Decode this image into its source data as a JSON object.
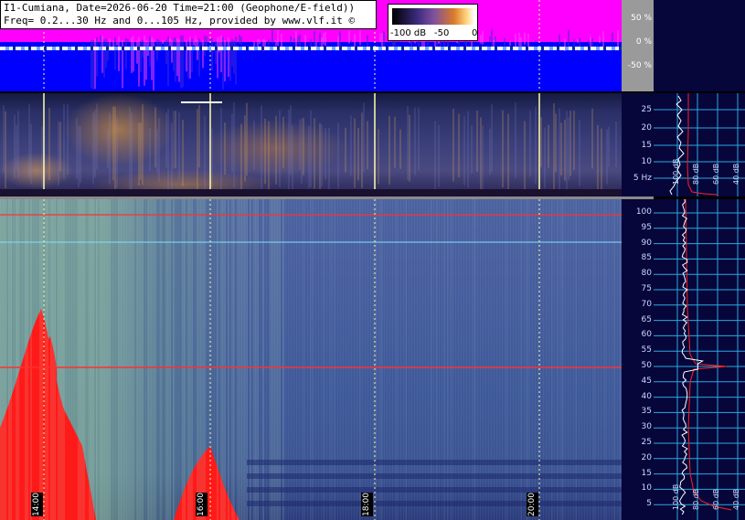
{
  "header": {
    "line1": "I1-Cumiana, Date=2026-06-20 Time=21:00 (Geophone/E-field))",
    "line2": "Freq= 0.2...30 Hz and 0...105 Hz, provided by www.vlf.it ©"
  },
  "colorbar": {
    "label_min": "-100 dB",
    "label_mid": "-50",
    "label_max": "0",
    "gradient_colors": [
      "#000000",
      "#3a2a7a",
      "#7d4fa0",
      "#d97a2a",
      "#ffd27a",
      "#ffffff"
    ]
  },
  "amplitude_axis": {
    "ticks": [
      "50 %",
      "0 %",
      "-50 %"
    ]
  },
  "geophone_axis": {
    "ticks": [
      "25",
      "20",
      "15",
      "10",
      "5 Hz"
    ]
  },
  "efield_axis": {
    "ticks": [
      "100",
      "95",
      "90",
      "85",
      "80",
      "75",
      "70",
      "65",
      "60",
      "55",
      "50",
      "45",
      "40",
      "35",
      "30",
      "25",
      "20",
      "15",
      "10",
      "5"
    ]
  },
  "time_labels": [
    "14:00",
    "16:00",
    "18:00",
    "20:00"
  ],
  "side_labels": {
    "geo": [
      "100 dB",
      "80 dB",
      "60 dB",
      "40 dB",
      "20 dB"
    ],
    "efield": [
      "100 dB",
      "80 dB",
      "60 dB",
      "40 dB",
      "20 dB"
    ]
  },
  "colors": {
    "amp_positive": "#ff00ff",
    "amp_negative": "#0000ff",
    "side_bg": "#06063a",
    "trace": "#ffffff",
    "marker_red": "#ff2020",
    "grid_cyan": "#2aa8e0"
  }
}
